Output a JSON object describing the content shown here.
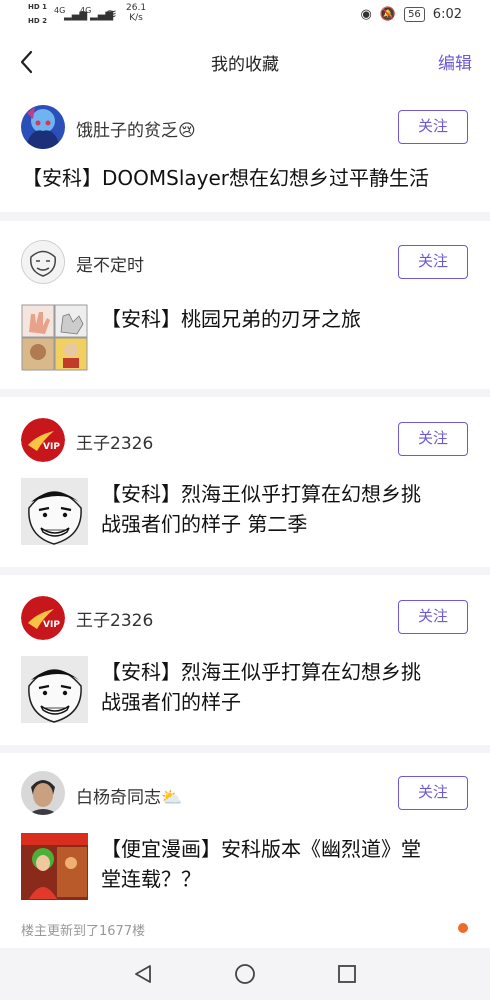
{
  "status_bar": {
    "hd1": "HD 1",
    "hd2": "HD 2",
    "sig1": "4G",
    "sig2": "4G",
    "speed_value": "26.1",
    "speed_unit": "K/s",
    "battery": "56",
    "time": "6:02"
  },
  "header": {
    "title": "我的收藏",
    "edit_label": "编辑"
  },
  "follow_label": "关注",
  "posts": [
    {
      "author": "饿肚子的贫乏😢",
      "title": "【安科】DOOMSlayer想在幻想乡过平静生活"
    },
    {
      "author": "是不定时",
      "title": "【安科】桃园兄弟的刃牙之旅"
    },
    {
      "author": "王子2326",
      "title_line1": "【安科】烈海王似乎打算在幻想乡挑",
      "title_line2": "战强者们的样子 第二季"
    },
    {
      "author": "王子2326",
      "title_line1": "【安科】烈海王似乎打算在幻想乡挑",
      "title_line2": "战强者们的样子"
    },
    {
      "author": "白杨奇同志⛅",
      "title_line1": "【便宜漫画】安科版本《幽烈道》堂",
      "title_line2": "堂连载？？"
    }
  ],
  "update_note": "楼主更新到了1677楼",
  "colors": {
    "accent": "#6b5ad6",
    "dot": "#f06a2b"
  }
}
